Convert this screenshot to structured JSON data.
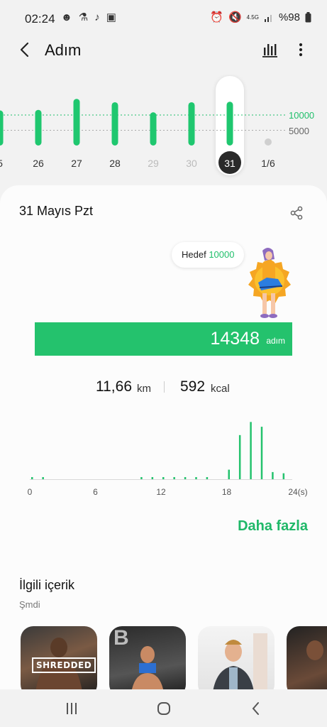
{
  "status": {
    "time": "02:24",
    "network": "4.5G",
    "battery": "%98",
    "icons": [
      "notification-dot-icon",
      "bell-icon",
      "music-note-icon",
      "app-icon",
      "alarm-icon",
      "mute-icon",
      "signal-icon",
      "battery-icon"
    ]
  },
  "header": {
    "title": "Adım",
    "back_icon": "chevron-left-icon",
    "chart_icon": "bar-chart-icon",
    "more_icon": "more-vertical-icon"
  },
  "day_chart": {
    "goal_labels": [
      "10000",
      "5000"
    ],
    "goal_color": "#1fbf6a",
    "bar_color": "#1fc76f",
    "days": [
      {
        "label": "5",
        "value": 11500,
        "dim": false
      },
      {
        "label": "26",
        "value": 11700,
        "dim": false
      },
      {
        "label": "27",
        "value": 15300,
        "dim": false
      },
      {
        "label": "28",
        "value": 14200,
        "dim": false
      },
      {
        "label": "29",
        "value": 10900,
        "dim": true
      },
      {
        "label": "30",
        "value": 14200,
        "dim": true
      },
      {
        "label": "31",
        "value": 14348,
        "dim": false,
        "selected": true
      },
      {
        "label": "1/6",
        "value": 0,
        "dim": false
      }
    ]
  },
  "summary": {
    "date": "31 Mayıs Pzt",
    "goal_label": "Hedef",
    "goal_value": "10000",
    "steps": "14348",
    "steps_unit": "adım",
    "distance": "11,66",
    "distance_unit": "km",
    "calories": "592",
    "calories_unit": "kcal",
    "share_icon": "share-icon",
    "accent": "#24c26d"
  },
  "chart_data": {
    "type": "bar",
    "x": [
      0,
      1,
      2,
      3,
      4,
      5,
      6,
      7,
      8,
      9,
      10,
      11,
      12,
      13,
      14,
      15,
      16,
      17,
      18,
      19,
      20,
      21,
      22,
      23
    ],
    "values": [
      40,
      30,
      0,
      0,
      0,
      0,
      0,
      0,
      0,
      0,
      40,
      40,
      40,
      40,
      40,
      40,
      40,
      0,
      400,
      1850,
      2400,
      2200,
      300,
      250
    ],
    "x_ticks": [
      "0",
      "6",
      "12",
      "18",
      "24(s)"
    ],
    "xlim": [
      0,
      24
    ]
  },
  "more_link": "Daha fazla",
  "related": {
    "title": "İlgili içerik",
    "subtitle": "Şmdi",
    "items": [
      {
        "label": "SHREDDED"
      },
      {
        "label": ""
      },
      {
        "label": ""
      },
      {
        "label": ""
      }
    ]
  },
  "navbar": {
    "icons": [
      "recent-apps-icon",
      "home-icon",
      "back-icon"
    ]
  }
}
